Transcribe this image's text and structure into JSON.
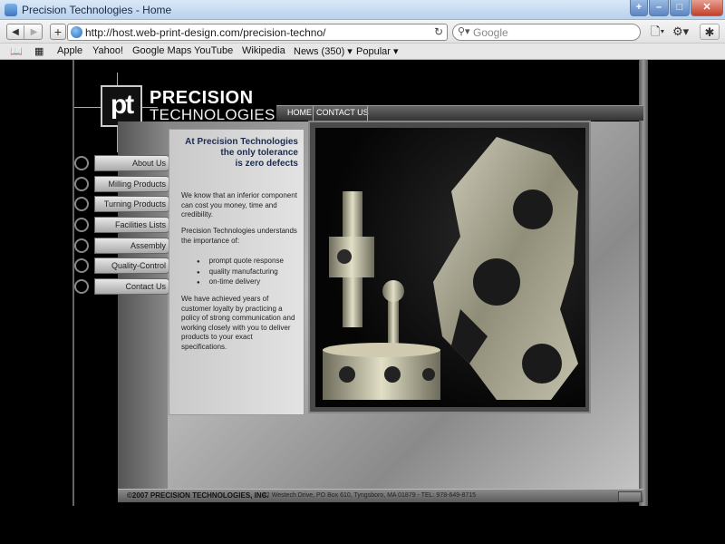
{
  "browser": {
    "window_title": "Precision Technologies - Home",
    "url": "http://host.web-print-design.com/precision-techno/",
    "search_placeholder": "Google",
    "bookmarks": [
      "Apple",
      "Yahoo!",
      "Google Maps",
      "YouTube",
      "Wikipedia",
      "News (350) ▾",
      "Popular ▾"
    ]
  },
  "site": {
    "logo_mark": "pt",
    "logo_line1": "PRECISION",
    "logo_line2": "TECHNOLOGIES",
    "top_nav": [
      "HOME",
      "CONTACT US"
    ],
    "side_nav": [
      "About Us",
      "Milling Products",
      "Turning Products",
      "Facilities Lists",
      "Assembly",
      "Quality-Control",
      "Contact Us"
    ],
    "headline": [
      "At Precision Technologies",
      "the only tolerance",
      "is zero defects"
    ],
    "para1": "We know that an inferior component can cost you money, time and credibility.",
    "para2": "Precision Technologies understands the importance of:",
    "bullets": [
      "prompt quote response",
      "quality manufacturing",
      "on-time delivery"
    ],
    "para3": "We have achieved years of customer loyalty by practicing a policy of strong communication and working closely with you to deliver products to your exact specifications.",
    "footer_copy": "©2007 PRECISION TECHNOLOGIES, INC.",
    "footer_address": "42 Westech Drive, PO Box 610, Tyngsboro, MA 01879 - TEL: 978-649-8715"
  },
  "colors": {
    "headline": "#1d2c4d",
    "background": "#000000"
  }
}
